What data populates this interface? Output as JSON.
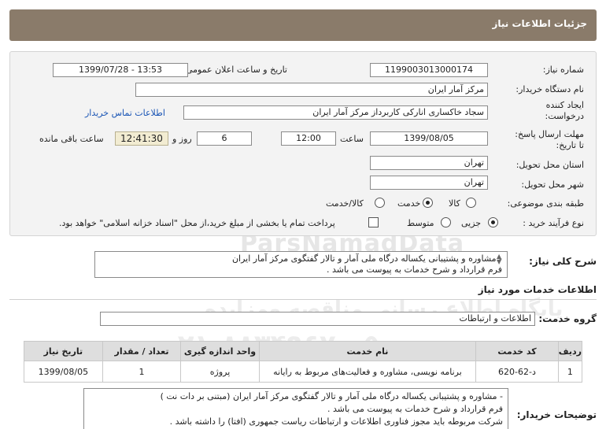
{
  "header": {
    "title": "جزئیات اطلاعات نیاز"
  },
  "form": {
    "need_number_label": "شماره نیاز:",
    "need_number": "1199003013000174",
    "announce_label": "تاریخ و ساعت اعلان عمومی:",
    "announce_value": "1399/07/28 - 13:53",
    "buyer_label": "نام دستگاه خریدار:",
    "buyer_value": "مرکز آمار ایران",
    "creator_label_1": "ایجاد کننده",
    "creator_label_2": "درخواست:",
    "creator_value": "سجاد خاکساری انارکی کاربرداز مرکز آمار ایران",
    "contact_link": "اطلاعات تماس خریدار",
    "deadline_label_1": "مهلت ارسال پاسخ:",
    "deadline_label_2": "تا تاریخ:",
    "deadline_date": "1399/08/05",
    "time_label": "ساعت",
    "deadline_time": "12:00",
    "days_value": "6",
    "days_label": "روز و",
    "remaining_time": "12:41:30",
    "remaining_label": "ساعت باقی مانده",
    "province_label": "استان محل تحویل:",
    "province_value": "تهران",
    "city_label": "شهر محل تحویل:",
    "city_value": "تهران",
    "category_label": "طبقه بندی موضوعی:",
    "category_options": [
      "کالا",
      "خدمت",
      "کالا/خدمت"
    ],
    "category_selected": "خدمت",
    "process_label": "نوع فرآیند خرید :",
    "process_options": [
      "جزیی",
      "متوسط"
    ],
    "process_selected": "جزیی",
    "payment_note": "پرداخت تمام یا بخشی از مبلغ خرید،از محل \"اسناد خزانه اسلامی\" خواهد بود."
  },
  "summary": {
    "label": "شرح کلی نیاز:",
    "line1": "- مشاوره و پشتیبانی یکساله درگاه ملی آمار و تالار گفتگوی مرکز آمار ایران",
    "line2": "فرم قرارداد و شرح خدمات به پیوست می باشد ."
  },
  "services": {
    "section_title": "اطلاعات خدمات مورد نیاز",
    "group_label": "گروه خدمت:",
    "group_value": "اطلاعات و ارتباطات",
    "columns": [
      "ردیف",
      "کد خدمت",
      "نام خدمت",
      "واحد اندازه گیری",
      "تعداد / مقدار",
      "تاریخ نیاز"
    ],
    "rows": [
      [
        "1",
        "د-62-620",
        "برنامه نویسی، مشاوره و فعالیت‌های مربوط به رایانه",
        "پروژه",
        "1",
        "1399/08/05"
      ]
    ]
  },
  "buyer_notes": {
    "label": "توضیحات خریدار:",
    "line1": "- مشاوره و پشتیبانی یکساله درگاه ملی آمار و تالار گفتگوی مرکز آمار ایران (مبتنی بر دات نت )",
    "line2": "فرم قرارداد و شرح خدمات به پیوست می باشد .",
    "line3": "شرکت مربوطه باید مجوز فناوری اطلاعات و ارتباطات ریاست جمهوری (افتا) را داشته باشد ."
  },
  "watermark": {
    "brand_en": "ParsNamadData",
    "line_fa": "پایگاه اطلاع رسانی مناقصه ومزایده",
    "phone": "۰۲۱-۸۸۳۴۹۶۷۰-۵"
  }
}
